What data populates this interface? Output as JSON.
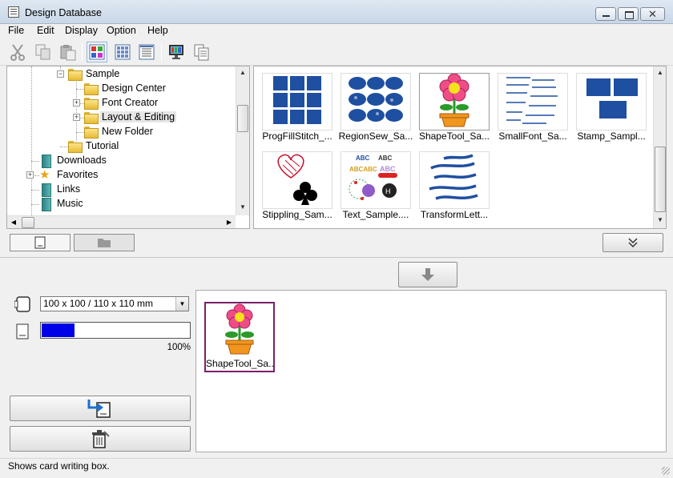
{
  "window": {
    "title": "Design Database",
    "close_glyph": "✕"
  },
  "menu": [
    "File",
    "Edit",
    "Display",
    "Option",
    "Help"
  ],
  "toolbar": {
    "buttons": [
      "cut-icon",
      "copy-icon",
      "paste-icon",
      "large-thumbnail-view-icon",
      "small-thumbnail-view-icon",
      "details-view-icon",
      "display-icon",
      "properties-icon"
    ]
  },
  "tree": {
    "items": [
      {
        "label": "Sample",
        "icon": "folder-icon",
        "expander": "−"
      },
      {
        "label": "Design Center",
        "icon": "folder-icon"
      },
      {
        "label": "Font Creator",
        "icon": "folder-icon",
        "expander": "+"
      },
      {
        "label": "Layout & Editing",
        "icon": "folder-icon",
        "expander": "+"
      },
      {
        "label": "New Folder",
        "icon": "folder-icon"
      },
      {
        "label": "Tutorial",
        "icon": "folder-icon"
      },
      {
        "label": "Downloads",
        "icon": "library-icon"
      },
      {
        "label": "Favorites",
        "icon": "star-icon",
        "expander": "+"
      },
      {
        "label": "Links",
        "icon": "library-icon"
      },
      {
        "label": "Music",
        "icon": "music-library-icon"
      }
    ]
  },
  "files": [
    {
      "label": "ProgFillStitch_...",
      "art": "grid"
    },
    {
      "label": "RegionSew_Sa...",
      "art": "ovals"
    },
    {
      "label": "ShapeTool_Sa...",
      "art": "flower"
    },
    {
      "label": "SmallFont_Sa...",
      "art": "text"
    },
    {
      "label": "Stamp_Sampl...",
      "art": "stamp"
    },
    {
      "label": "Stippling_Sam...",
      "art": "heart-club"
    },
    {
      "label": "Text_Sample....",
      "art": "colortext"
    },
    {
      "label": "TransformLett...",
      "art": "waves"
    }
  ],
  "selected_file": "ShapeTool_Sa...",
  "writer": {
    "hoop_size": "100 x 100 / 110 x 110 mm",
    "progress_percent": 100,
    "progress_fill_fraction": 0.22,
    "progress_label": "100%"
  },
  "card": {
    "items": [
      {
        "label": "ShapeTool_Sa..."
      }
    ]
  },
  "status": {
    "text": "Shows card writing box."
  }
}
